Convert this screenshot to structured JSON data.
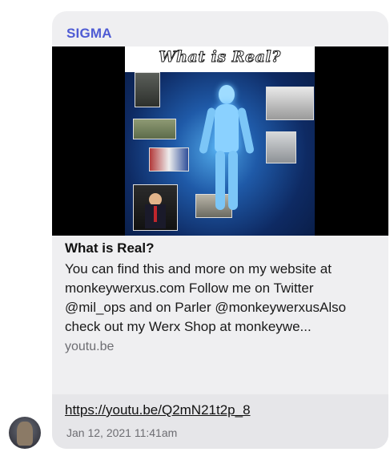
{
  "message": {
    "sender": "SIGMA",
    "preview": {
      "image_title": "What is Real?",
      "title": "What is Real?",
      "description": "You can find this and more on my website at monkeywerxus.com Follow me on Twitter @mil_ops and on Parler @monkeywerxusAlso check out my Werx Shop at monkeywe...",
      "domain": "youtu.be"
    },
    "url": "https://youtu.be/Q2mN21t2p_8",
    "timestamp": "Jan 12, 2021 11:41am"
  },
  "colors": {
    "sender": "#4e5bd4",
    "bubble": "#efeff1",
    "link_strip": "#e6e6e9"
  },
  "icons": {
    "avatar": "user-avatar-photo"
  }
}
